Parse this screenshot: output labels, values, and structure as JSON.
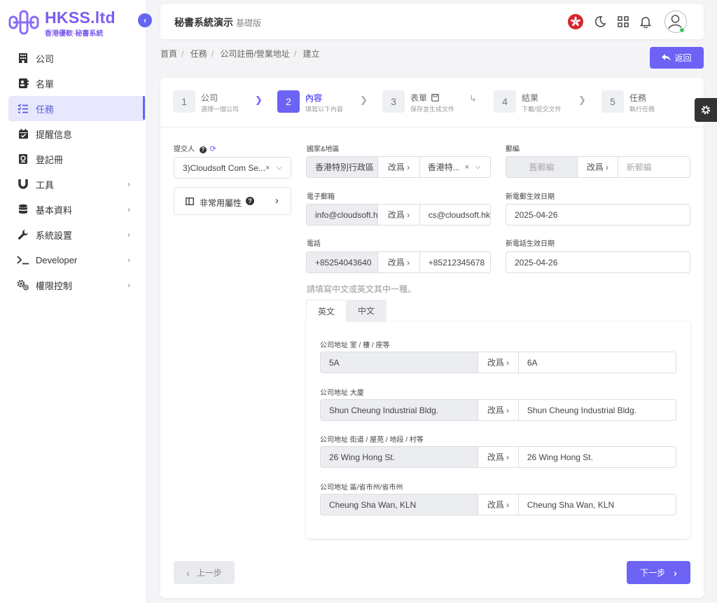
{
  "brand": {
    "name": "HKSS.ltd",
    "tagline": "香港優軟·秘書系統"
  },
  "sidebar": {
    "items": [
      {
        "label": "公司",
        "icon": "building-icon"
      },
      {
        "label": "名單",
        "icon": "contact-card-icon"
      },
      {
        "label": "任務",
        "icon": "task-list-icon",
        "active": true
      },
      {
        "label": "提醒信息",
        "icon": "calendar-check-icon"
      },
      {
        "label": "登記冊",
        "icon": "register-book-icon"
      },
      {
        "label": "工具",
        "icon": "magnet-icon",
        "has_children": true
      },
      {
        "label": "基本資料",
        "icon": "database-icon",
        "has_children": true
      },
      {
        "label": "系統設置",
        "icon": "wrench-icon",
        "has_children": true
      },
      {
        "label": "Developer",
        "icon": "terminal-icon",
        "has_children": true
      },
      {
        "label": "權限控制",
        "icon": "gears-icon",
        "has_children": true
      }
    ]
  },
  "header": {
    "title": "秘書系統演示",
    "subtitle": "基礎版"
  },
  "breadcrumb": [
    "首頁",
    "任務",
    "公司註冊/營業地址",
    "建立"
  ],
  "back_button": "返回",
  "steps": [
    {
      "num": "1",
      "title": "公司",
      "desc": "選擇一個公司"
    },
    {
      "num": "2",
      "title": "內容",
      "desc": "填寫以下內容",
      "active": true
    },
    {
      "num": "3",
      "title": "表單",
      "desc": "保存並生成文件"
    },
    {
      "num": "4",
      "title": "結果",
      "desc": "下載/提交文件"
    },
    {
      "num": "5",
      "title": "任務",
      "desc": "執行任務"
    }
  ],
  "form": {
    "submitter_label": "提交人",
    "submitter_value": "3)Cloudsoft Com Se...",
    "misc_label": "非常用屬性",
    "change_label": "改爲 ›",
    "country": {
      "label": "國家&地區",
      "old": "香港特別行政區",
      "new": "香港特..."
    },
    "postcode": {
      "label": "郵編",
      "old_placeholder": "舊郵編",
      "new_placeholder": "新郵編"
    },
    "email": {
      "label": "電子郵箱",
      "old": "info@cloudsoft.hk",
      "new": "cs@cloudsoft.hk"
    },
    "email_date": {
      "label": "新電郵生效日期",
      "value": "2025-04-26"
    },
    "phone": {
      "label": "電話",
      "old": "+85254043640",
      "new": "+85212345678"
    },
    "phone_date": {
      "label": "新電話生效日期",
      "value": "2025-04-26"
    },
    "hint": "請填寫中文或英文其中一種。",
    "tabs": [
      "英文",
      "中文"
    ],
    "address": [
      {
        "label": "公司地址 室 / 樓 / 座等",
        "old": "5A",
        "new": "6A"
      },
      {
        "label": "公司地址 大廈",
        "old": "Shun Cheung Industrial Bldg.",
        "new": "Shun Cheung Industrial Bldg."
      },
      {
        "label": "公司地址 街道 / 屋苑 / 地段 / 村等",
        "old": "26 Wing Hong St.",
        "new": "26 Wing Hong St."
      },
      {
        "label": "公司地址 區/省市州/省市州",
        "old": "Cheung Sha Wan, KLN",
        "new": "Cheung Sha Wan, KLN"
      }
    ]
  },
  "footer": {
    "prev": "上一步",
    "next": "下一步"
  },
  "colors": {
    "accent": "#6c63f5",
    "brand": "#7c5cf0",
    "active_nav_bg": "#e7e8fd"
  }
}
